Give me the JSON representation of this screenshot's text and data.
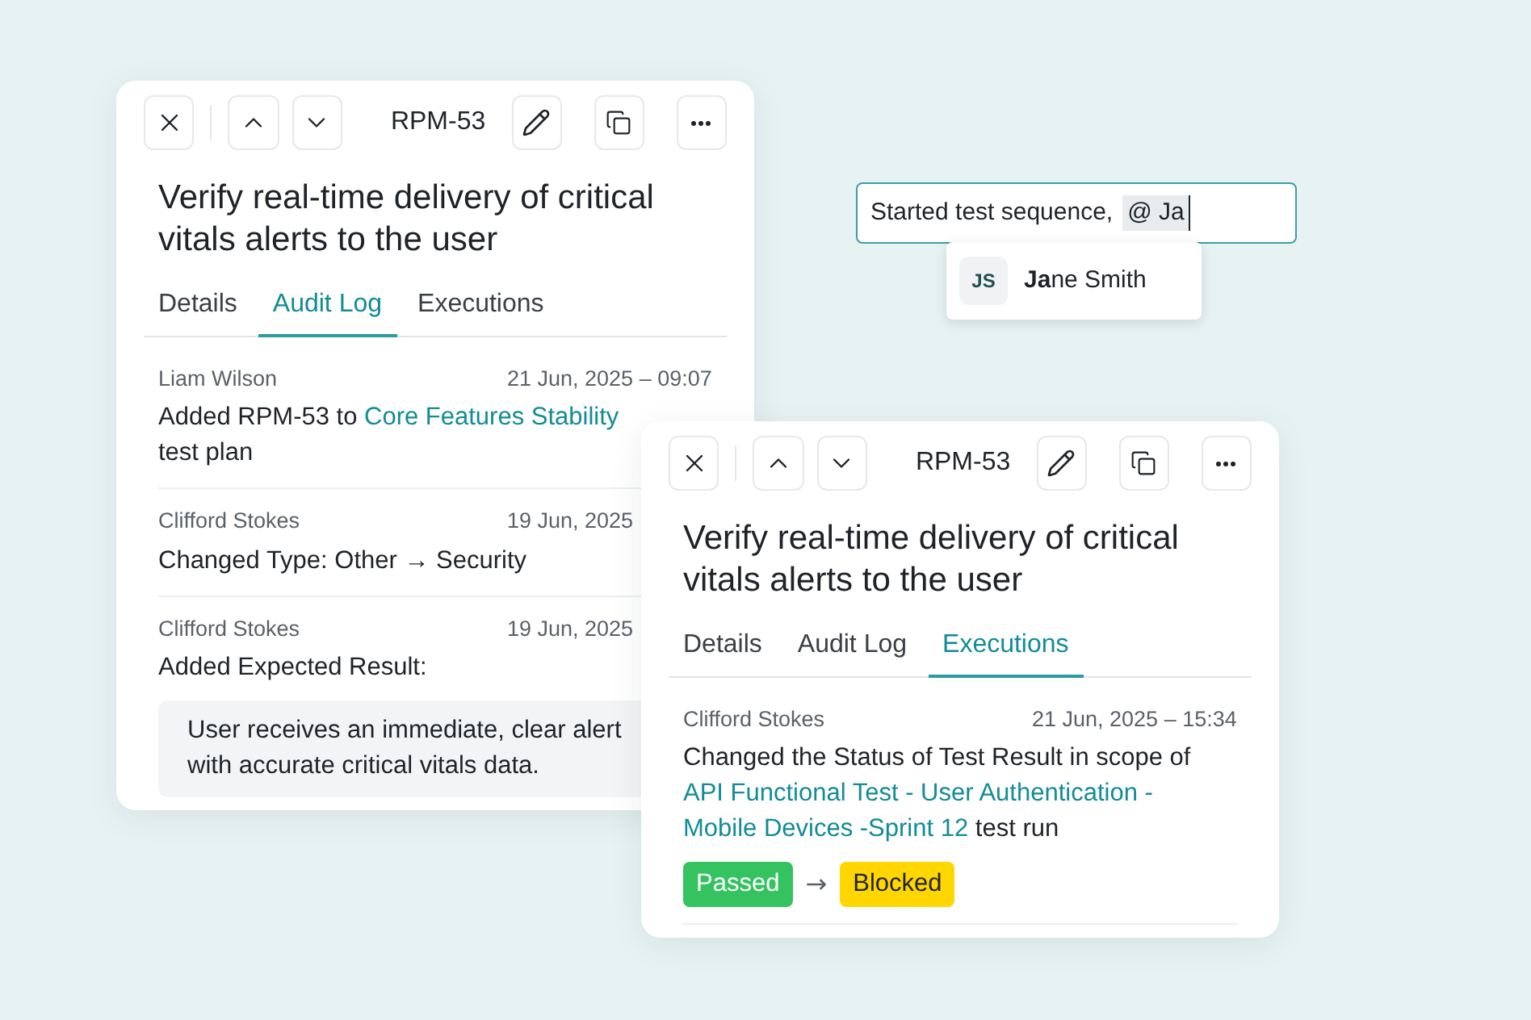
{
  "panels": [
    {
      "key": "RPM-53",
      "title": "Verify real-time delivery of critical vitals alerts to the user",
      "tabs": [
        {
          "label": "Details",
          "selected": false
        },
        {
          "label": "Audit Log",
          "selected": true
        },
        {
          "label": "Executions",
          "selected": false
        }
      ],
      "entries": [
        {
          "kind": "text",
          "author": "Liam Wilson",
          "time": "21 Jun, 2025 – 09:07",
          "message": {
            "before": "Added RPM-53 to ",
            "link": [
              "Core Features Stability"
            ],
            "after": " test plan"
          }
        },
        {
          "kind": "text",
          "author": "Clifford Stokes",
          "time": "19 Jun, 2025",
          "message": {
            "before": "Changed Type: Other → Security"
          }
        },
        {
          "kind": "quote",
          "author": "Clifford Stokes",
          "time": "19 Jun, 2025",
          "message": {
            "before": "Added Expected Result:"
          },
          "quote": [
            "User receives an immediate, clear alert",
            "with accurate critical vitals data."
          ]
        }
      ]
    },
    {
      "key": "RPM-53",
      "title": "Verify real-time delivery of critical vitals alerts to the user",
      "tabs": [
        {
          "label": "Details",
          "selected": false
        },
        {
          "label": "Audit Log",
          "selected": false
        },
        {
          "label": "Executions",
          "selected": true
        }
      ],
      "entries": [
        {
          "kind": "status",
          "author": "Clifford Stokes",
          "time": "21 Jun, 2025 – 15:34",
          "message": {
            "before": "Changed the Status of Test Result in scope of ",
            "link": [
              "API Functional Test - User Authentication -",
              "Mobile Devices -Sprint 12"
            ],
            "after": " test run"
          },
          "from": {
            "label": "Passed",
            "color": "#34c35f"
          },
          "to": {
            "label": "Blocked",
            "color": "#ffd600"
          },
          "arrow": "→"
        }
      ]
    }
  ],
  "comment": {
    "value": "Started test sequence,",
    "mention": "@ Ja",
    "suggestions": [
      {
        "initials": "JS",
        "name": "**Ja**ne Smith"
      }
    ]
  }
}
